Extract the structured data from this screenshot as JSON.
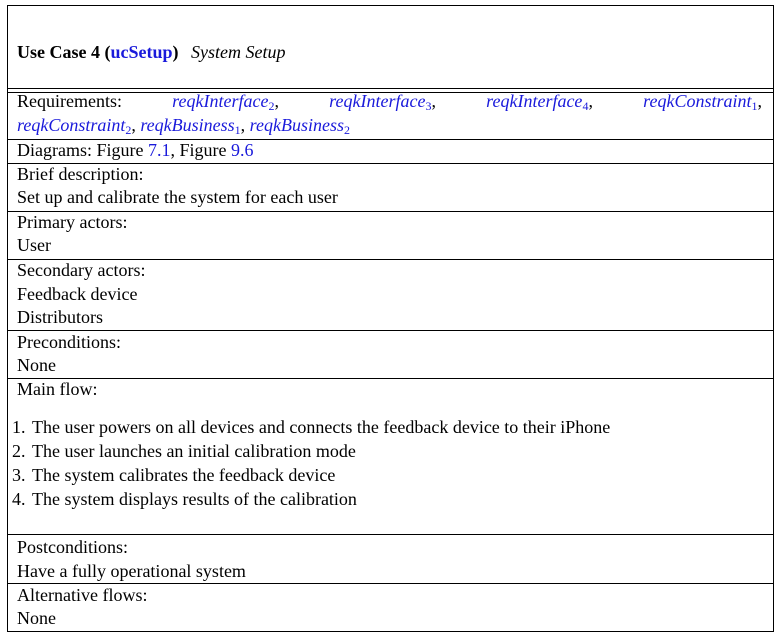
{
  "header": {
    "use_case_label": "Use Case 4",
    "use_case_id": "ucSetup",
    "use_case_name": "System Setup"
  },
  "requirements": {
    "label": "Requirements:",
    "items": [
      {
        "name": "reqkInterface",
        "sub": "2"
      },
      {
        "name": "reqkInterface",
        "sub": "3"
      },
      {
        "name": "reqkInterface",
        "sub": "4"
      },
      {
        "name": "reqkConstraint",
        "sub": "1"
      },
      {
        "name": "reqkConstraint",
        "sub": "2"
      },
      {
        "name": "reqkBusiness",
        "sub": "1"
      },
      {
        "name": "reqkBusiness",
        "sub": "2"
      }
    ]
  },
  "diagrams": {
    "label": "Diagrams: Figure",
    "figure1": "7.1",
    "sep": ", Figure",
    "figure2": "9.6"
  },
  "brief_description": {
    "label": "Brief description:",
    "text": "Set up and calibrate the system for each user"
  },
  "primary_actors": {
    "label": "Primary actors:",
    "items": [
      "User"
    ]
  },
  "secondary_actors": {
    "label": "Secondary actors:",
    "items": [
      "Feedback device",
      "Distributors"
    ]
  },
  "preconditions": {
    "label": "Preconditions:",
    "text": "None"
  },
  "main_flow": {
    "label": "Main flow:",
    "steps": [
      {
        "num": "1.",
        "text": "The user powers on all devices and connects the feedback device to their iPhone"
      },
      {
        "num": "2.",
        "text": "The user launches an initial calibration mode"
      },
      {
        "num": "3.",
        "text": "The system calibrates the feedback device"
      },
      {
        "num": "4.",
        "text": "The system displays results of the calibration"
      }
    ]
  },
  "postconditions": {
    "label": "Postconditions:",
    "text": "Have a fully operational system"
  },
  "alternative_flows": {
    "label": "Alternative flows:",
    "text": "None"
  },
  "colors": {
    "link": "#1a1adb",
    "border": "#000000"
  }
}
